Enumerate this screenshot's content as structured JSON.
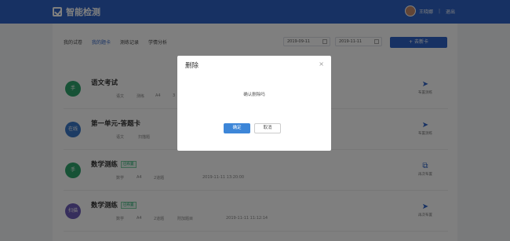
{
  "app": {
    "title": "智能检测",
    "user_name": "王晓娜",
    "logout": "退出"
  },
  "tabs": [
    {
      "label": "我的试卷",
      "active": false
    },
    {
      "label": "我的题卡",
      "active": true
    },
    {
      "label": "测练记录",
      "active": false
    },
    {
      "label": "学情分析",
      "active": false
    }
  ],
  "filters": {
    "start_date": "2019-09-11",
    "end_date": "2019-11-11",
    "create_button": "+ 去新卡"
  },
  "rows": [
    {
      "badge": "手",
      "badge_color": "#2ea46c",
      "title": "语文考试",
      "tag": "",
      "meta": [
        "语文",
        "测练",
        "A4",
        "3"
      ],
      "action": "布置测练"
    },
    {
      "badge": "在线",
      "badge_color": "#3b78c8",
      "title": "第一单元-答题卡",
      "tag": "",
      "meta": [
        "语文",
        "扫描题",
        ""
      ],
      "action": "布置测练"
    },
    {
      "badge": "手",
      "badge_color": "#2ea46c",
      "title": "数学测练",
      "tag": "已布置",
      "meta": [
        "数学",
        "A4",
        "2道题",
        "2019-11-11 13:20:00"
      ],
      "action": "再次布置"
    },
    {
      "badge": "扫描",
      "badge_color": "#6c5cb8",
      "title": "数学测练",
      "tag": "已布置",
      "meta": [
        "数学",
        "A4",
        "2道题",
        "附加题目",
        "2019-11-11 11:12:14"
      ],
      "action": "再次布置"
    }
  ],
  "dialog": {
    "title": "删除",
    "message": "确认删除吗",
    "ok": "确定",
    "cancel": "取消"
  }
}
